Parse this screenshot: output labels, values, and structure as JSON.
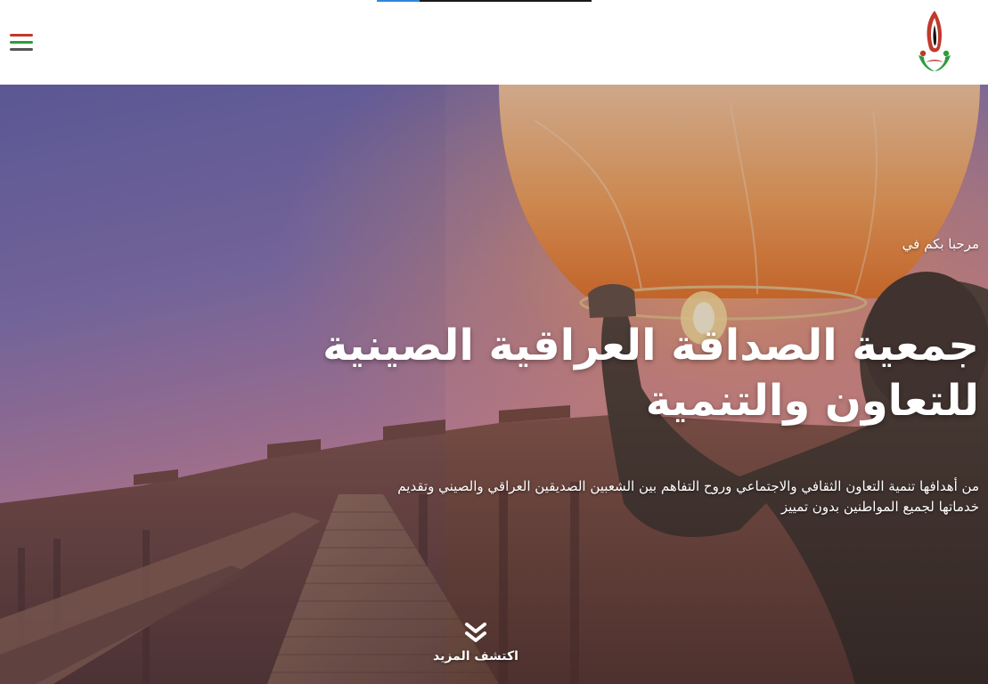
{
  "header": {
    "progress_percent": 20,
    "menu_icon": "hamburger-menu-icon",
    "logo_icon": "society-logo-icon",
    "colors": {
      "menu_top": "#c0392b",
      "menu_middle": "#2e9b3e",
      "menu_bottom": "#555555",
      "progress_fill": "#2e86de"
    }
  },
  "hero": {
    "welcome": "مرحبا بكم في",
    "title": "جمعية الصداقة العراقية الصينية للتعاون والتنمية",
    "description": "من أهدافها تنمية التعاون الثقافي والاجتماعي وروح التفاهم بين الشعبين الصديقين العراقي والصيني وتقديم خدماتها لجميع المواطنين بدون تمييز",
    "explore_label": "اكتشف المزيد",
    "explore_icon": "double-chevron-down-icon",
    "text_color": "#ffffff"
  }
}
